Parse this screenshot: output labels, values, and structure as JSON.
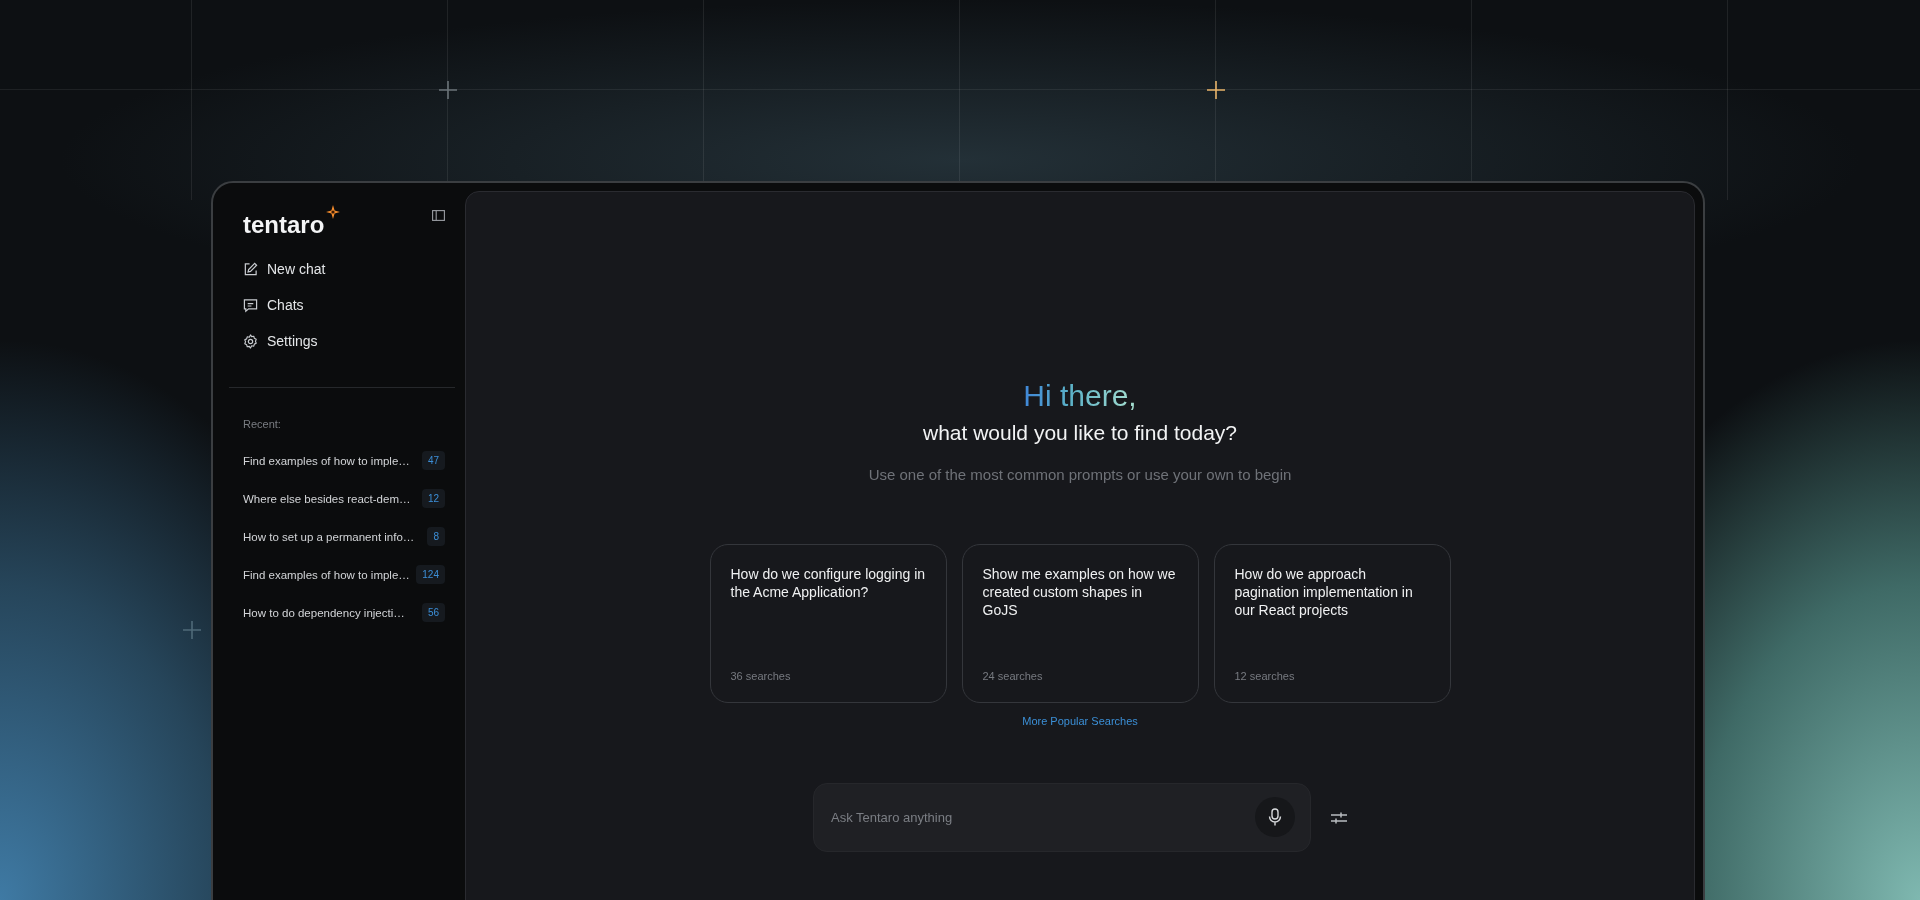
{
  "sidebar": {
    "logo": "tentaro",
    "nav": [
      {
        "kind": "new",
        "label": "New chat"
      },
      {
        "kind": "chats",
        "label": "Chats"
      },
      {
        "kind": "settings",
        "label": "Settings"
      }
    ],
    "recent_heading": "Recent:",
    "recent": [
      {
        "title": "Find examples of how to imple…",
        "count": "47"
      },
      {
        "title": "Where else besides react-dem…",
        "count": "12"
      },
      {
        "title": "How to set up a permanent info…",
        "count": "8"
      },
      {
        "title": "Find examples of how to imple…",
        "count": "124"
      },
      {
        "title": "How to do dependency injecti…",
        "count": "56"
      }
    ]
  },
  "main": {
    "greeting": "Hi there,",
    "question": "what would you like to find today?",
    "hint": "Use one of the most common prompts or use your own to begin",
    "prompts": [
      {
        "text": "How do we configure logging in the Acme Application?",
        "searches": "36 searches"
      },
      {
        "text": "Show me examples on how we created custom shapes in GoJS",
        "searches": "24 searches"
      },
      {
        "text": "How do we approach pagination implementation in our React projects",
        "searches": "12 searches"
      }
    ],
    "more_link": "More Popular Searches",
    "search": {
      "placeholder": "Ask Tentaro anything"
    }
  }
}
